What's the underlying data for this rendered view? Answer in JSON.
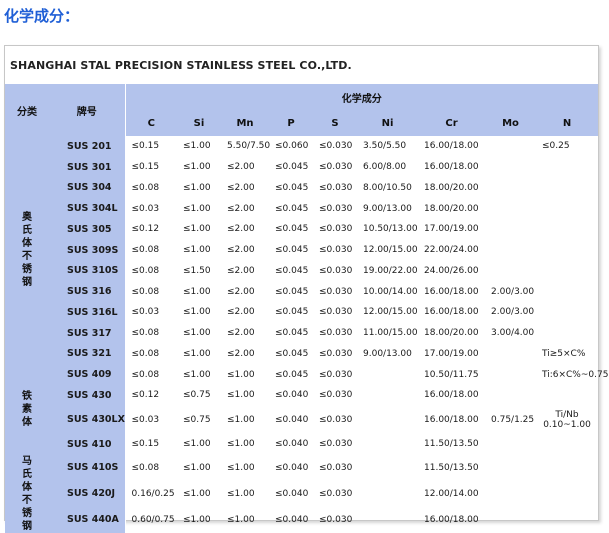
{
  "title": "化学成分：",
  "company": "SHANGHAI STAL PRECISION STAINLESS STEEL CO.,LTD.",
  "header": {
    "category": "分类",
    "grade": "牌号",
    "composition": "化学成分",
    "elements": [
      "C",
      "Si",
      "Mn",
      "P",
      "S",
      "Ni",
      "Cr",
      "Mo",
      "N"
    ]
  },
  "categories": [
    {
      "label": "奥氏体不锈钢",
      "row_span": 11
    },
    {
      "label": "铁素体",
      "row_span": 4
    },
    {
      "label": "马氏体不锈钢",
      "row_span": 4
    }
  ],
  "rows": [
    {
      "grade": "SUS 201",
      "C": "≤0.15",
      "Si": "≤1.00",
      "Mn": "5.50/7.50",
      "P": "≤0.060",
      "S": "≤0.030",
      "Ni": "3.50/5.50",
      "Cr": "16.00/18.00",
      "Mo": "",
      "N": "≤0.25"
    },
    {
      "grade": "SUS 301",
      "C": "≤0.15",
      "Si": "≤1.00",
      "Mn": "≤2.00",
      "P": "≤0.045",
      "S": "≤0.030",
      "Ni": "6.00/8.00",
      "Cr": "16.00/18.00",
      "Mo": "",
      "N": ""
    },
    {
      "grade": "SUS 304",
      "C": "≤0.08",
      "Si": "≤1.00",
      "Mn": "≤2.00",
      "P": "≤0.045",
      "S": "≤0.030",
      "Ni": "8.00/10.50",
      "Cr": "18.00/20.00",
      "Mo": "",
      "N": ""
    },
    {
      "grade": "SUS 304L",
      "C": "≤0.03",
      "Si": "≤1.00",
      "Mn": "≤2.00",
      "P": "≤0.045",
      "S": "≤0.030",
      "Ni": "9.00/13.00",
      "Cr": "18.00/20.00",
      "Mo": "",
      "N": ""
    },
    {
      "grade": "SUS 305",
      "C": "≤0.12",
      "Si": "≤1.00",
      "Mn": "≤2.00",
      "P": "≤0.045",
      "S": "≤0.030",
      "Ni": "10.50/13.00",
      "Cr": "17.00/19.00",
      "Mo": "",
      "N": ""
    },
    {
      "grade": "SUS 309S",
      "C": "≤0.08",
      "Si": "≤1.00",
      "Mn": "≤2.00",
      "P": "≤0.045",
      "S": "≤0.030",
      "Ni": "12.00/15.00",
      "Cr": "22.00/24.00",
      "Mo": "",
      "N": ""
    },
    {
      "grade": "SUS 310S",
      "C": "≤0.08",
      "Si": "≤1.50",
      "Mn": "≤2.00",
      "P": "≤0.045",
      "S": "≤0.030",
      "Ni": "19.00/22.00",
      "Cr": "24.00/26.00",
      "Mo": "",
      "N": ""
    },
    {
      "grade": "SUS 316",
      "C": "≤0.08",
      "Si": "≤1.00",
      "Mn": "≤2.00",
      "P": "≤0.045",
      "S": "≤0.030",
      "Ni": "10.00/14.00",
      "Cr": "16.00/18.00",
      "Mo": "2.00/3.00",
      "N": ""
    },
    {
      "grade": "SUS 316L",
      "C": "≤0.03",
      "Si": "≤1.00",
      "Mn": "≤2.00",
      "P": "≤0.045",
      "S": "≤0.030",
      "Ni": "12.00/15.00",
      "Cr": "16.00/18.00",
      "Mo": "2.00/3.00",
      "N": ""
    },
    {
      "grade": "SUS 317",
      "C": "≤0.08",
      "Si": "≤1.00",
      "Mn": "≤2.00",
      "P": "≤0.045",
      "S": "≤0.030",
      "Ni": "11.00/15.00",
      "Cr": "18.00/20.00",
      "Mo": "3.00/4.00",
      "N": ""
    },
    {
      "grade": "SUS 321",
      "C": "≤0.08",
      "Si": "≤1.00",
      "Mn": "≤2.00",
      "P": "≤0.045",
      "S": "≤0.030",
      "Ni": "9.00/13.00",
      "Cr": "17.00/19.00",
      "Mo": "",
      "N": "Ti≥5×C%"
    },
    {
      "grade": "SUS 409",
      "C": "≤0.08",
      "Si": "≤1.00",
      "Mn": "≤1.00",
      "P": "≤0.045",
      "S": "≤0.030",
      "Ni": "",
      "Cr": "10.50/11.75",
      "Mo": "",
      "N": "Ti:6×C%~0.75"
    },
    {
      "grade": "SUS 430",
      "C": "≤0.12",
      "Si": "≤0.75",
      "Mn": "≤1.00",
      "P": "≤0.040",
      "S": "≤0.030",
      "Ni": "",
      "Cr": "16.00/18.00",
      "Mo": "",
      "N": ""
    },
    {
      "grade": "SUS 430LX",
      "C": "≤0.03",
      "Si": "≤0.75",
      "Mn": "≤1.00",
      "P": "≤0.040",
      "S": "≤0.030",
      "Ni": "",
      "Cr": "16.00/18.00",
      "Mo": "0.75/1.25",
      "N": "Ti/Nb",
      "N2": "0.10~1.00",
      "tall": true
    },
    {
      "grade": "SUS 410",
      "C": "≤0.15",
      "Si": "≤1.00",
      "Mn": "≤1.00",
      "P": "≤0.040",
      "S": "≤0.030",
      "Ni": "",
      "Cr": "11.50/13.50",
      "Mo": "",
      "N": ""
    },
    {
      "grade": "SUS 410S",
      "C": "≤0.08",
      "Si": "≤1.00",
      "Mn": "≤1.00",
      "P": "≤0.040",
      "S": "≤0.030",
      "Ni": "",
      "Cr": "11.50/13.50",
      "Mo": "",
      "N": ""
    },
    {
      "grade": "SUS 420J",
      "C": "0.16/0.25",
      "Si": "≤1.00",
      "Mn": "≤1.00",
      "P": "≤0.040",
      "S": "≤0.030",
      "Ni": "",
      "Cr": "12.00/14.00",
      "Mo": "",
      "N": ""
    },
    {
      "grade": "SUS 440A",
      "C": "0.60/0.75",
      "Si": "≤1.00",
      "Mn": "≤1.00",
      "P": "≤0.040",
      "S": "≤0.030",
      "Ni": "",
      "Cr": "16.00/18.00",
      "Mo": "",
      "N": ""
    }
  ],
  "colors": {
    "title": "#1f5fd6",
    "header_bg": "#b3c3ec"
  }
}
